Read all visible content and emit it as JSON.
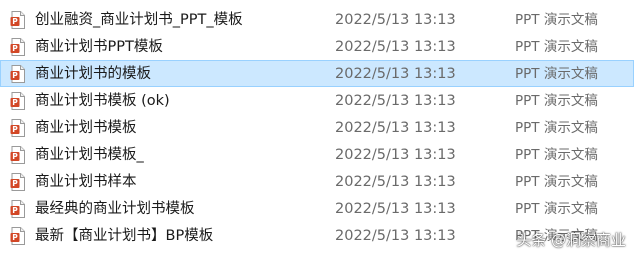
{
  "file_icon": "pptx-file-icon",
  "accent_color": "#d24726",
  "selected_row_color": "#cce8ff",
  "files": [
    {
      "name": "创业融资_商业计划书_PPT_模板",
      "modified": "2022/5/13 13:13",
      "type": "PPT 演示文稿"
    },
    {
      "name": "商业计划书PPT模板",
      "modified": "2022/5/13 13:13",
      "type": "PPT 演示文稿"
    },
    {
      "name": "商业计划书的模板",
      "modified": "2022/5/13 13:13",
      "type": "PPT 演示文稿",
      "selected": true
    },
    {
      "name": "商业计划书模板 (ok)",
      "modified": "2022/5/13 13:13",
      "type": "PPT 演示文稿"
    },
    {
      "name": "商业计划书模板",
      "modified": "2022/5/13 13:13",
      "type": "PPT 演示文稿"
    },
    {
      "name": "商业计划书模板_",
      "modified": "2022/5/13 13:13",
      "type": "PPT 演示文稿"
    },
    {
      "name": "商业计划书样本",
      "modified": "2022/5/13 13:13",
      "type": "PPT 演示文稿"
    },
    {
      "name": "最经典的商业计划书模板",
      "modified": "2022/5/13 13:13",
      "type": "PPT 演示文稿"
    },
    {
      "name": "最新【商业计划书】BP模板",
      "modified": "2022/5/13 13:13",
      "type": "PPT 演示文稿"
    }
  ],
  "watermark": "头条 @洞察商业"
}
